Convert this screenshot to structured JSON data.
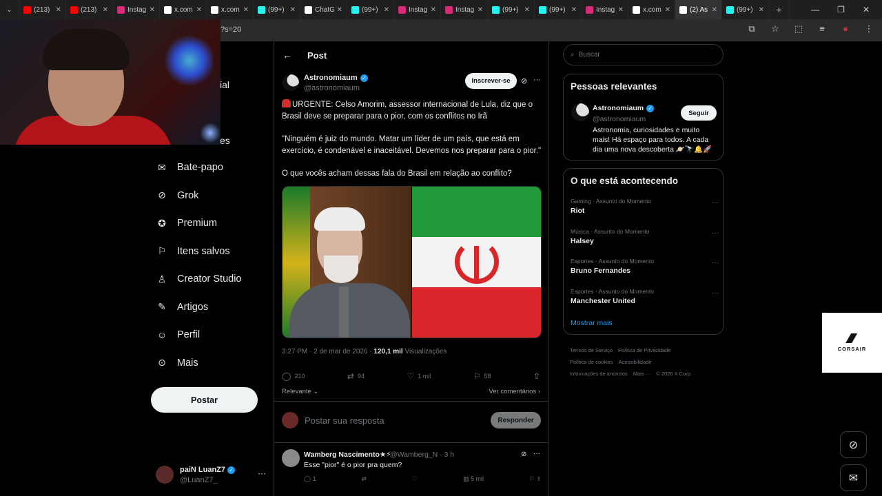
{
  "browser": {
    "tabs": [
      {
        "label": "(213)",
        "color": "#ff0000"
      },
      {
        "label": "(213)",
        "color": "#ff0000"
      },
      {
        "label": "Instag",
        "color": "#d62976"
      },
      {
        "label": "x.com",
        "color": "#ffffff"
      },
      {
        "label": "x.com",
        "color": "#ffffff"
      },
      {
        "label": "(99+)",
        "color": "#25f4ee"
      },
      {
        "label": "ChatG",
        "color": "#ffffff"
      },
      {
        "label": "(99+)",
        "color": "#25f4ee"
      },
      {
        "label": "Instag",
        "color": "#d62976"
      },
      {
        "label": "Instag",
        "color": "#d62976"
      },
      {
        "label": "(99+)",
        "color": "#25f4ee"
      },
      {
        "label": "(99+)",
        "color": "#25f4ee"
      },
      {
        "label": "Instag",
        "color": "#d62976"
      },
      {
        "label": "x.com",
        "color": "#ffffff"
      },
      {
        "label": "(2) As",
        "color": "#ffffff",
        "active": true
      },
      {
        "label": "(99+)",
        "color": "#25f4ee"
      }
    ],
    "url_fragment": "?s=20"
  },
  "nav": {
    "cut_items": [
      "ial",
      "es"
    ],
    "items": [
      {
        "label": "Bate-papo",
        "icon": "mail-icon"
      },
      {
        "label": "Grok",
        "icon": "grok-icon"
      },
      {
        "label": "Premium",
        "icon": "premium-icon"
      },
      {
        "label": "Itens salvos",
        "icon": "bookmark-icon"
      },
      {
        "label": "Creator Studio",
        "icon": "creator-icon"
      },
      {
        "label": "Artigos",
        "icon": "article-icon"
      },
      {
        "label": "Perfil",
        "icon": "profile-icon"
      },
      {
        "label": "Mais",
        "icon": "more-circle-icon"
      }
    ],
    "post_label": "Postar",
    "me": {
      "name": "paiN LuanZ7",
      "handle": "@LuanZ7_"
    }
  },
  "post": {
    "header_title": "Post",
    "author": {
      "name": "Astronomiaum",
      "handle": "@astronomiaum"
    },
    "subscribe_label": "Inscrever-se",
    "para1": "URGENTE: Celso Amorim, assessor internacional de Lula, diz que o Brasil deve se preparar para o pior, com os conflitos no Irã",
    "para2": "\"Ninguém é juiz do mundo. Matar um líder de um país, que está em exercício, é condenável e inaceitável. Devemos nos preparar para o pior.\"",
    "para3": "O que vocês acham dessas fala do Brasil em relação ao conflito?",
    "timestamp": "3:27 PM · 2 de mar de 2026 · ",
    "views_count": "120,1 mil",
    "views_label": " Visualizações",
    "replies": "210",
    "reposts": "94",
    "likes": "1 mil",
    "bookmarks": "58",
    "sort_label": "Relevante",
    "view_comments": "Ver comentários"
  },
  "reply_box": {
    "placeholder": "Postar sua resposta",
    "button": "Responder"
  },
  "comment": {
    "name": "Wamberg Nascimento★⚡",
    "handle": "@Wamberg_N · 3 h",
    "text": "Esse \"pior\" é o pior pra quem?",
    "replies": "1",
    "views": "5 mil"
  },
  "sidebar": {
    "search_placeholder": "Buscar",
    "relevant_title": "Pessoas relevantes",
    "relevant": {
      "name": "Astronomiaum",
      "handle": "@astronomiaum",
      "follow": "Seguir",
      "bio": "Astronomia, curiosidades e muito mais! Há espaço para todos. A cada dia uma nova descoberta 🪐🔭🔔🚀"
    },
    "trends_title": "O que está acontecendo",
    "trends": [
      {
        "category": "Gaming · Assunto do Momento",
        "name": "Riot"
      },
      {
        "category": "Música · Assunto do Momento",
        "name": "Halsey"
      },
      {
        "category": "Esportes · Assunto do Momento",
        "name": "Bruno Fernandes"
      },
      {
        "category": "Esportes · Assunto do Momento",
        "name": "Manchester United"
      }
    ],
    "show_more": "Mostrar mais",
    "footer": [
      "Termos de Serviço",
      "Política de Privacidade",
      "Política de cookies",
      "Acessibilidade",
      "Informações de anúncios",
      "Mais ···",
      "© 2026 X Corp."
    ]
  },
  "ad": {
    "brand": "CORSAIR"
  }
}
